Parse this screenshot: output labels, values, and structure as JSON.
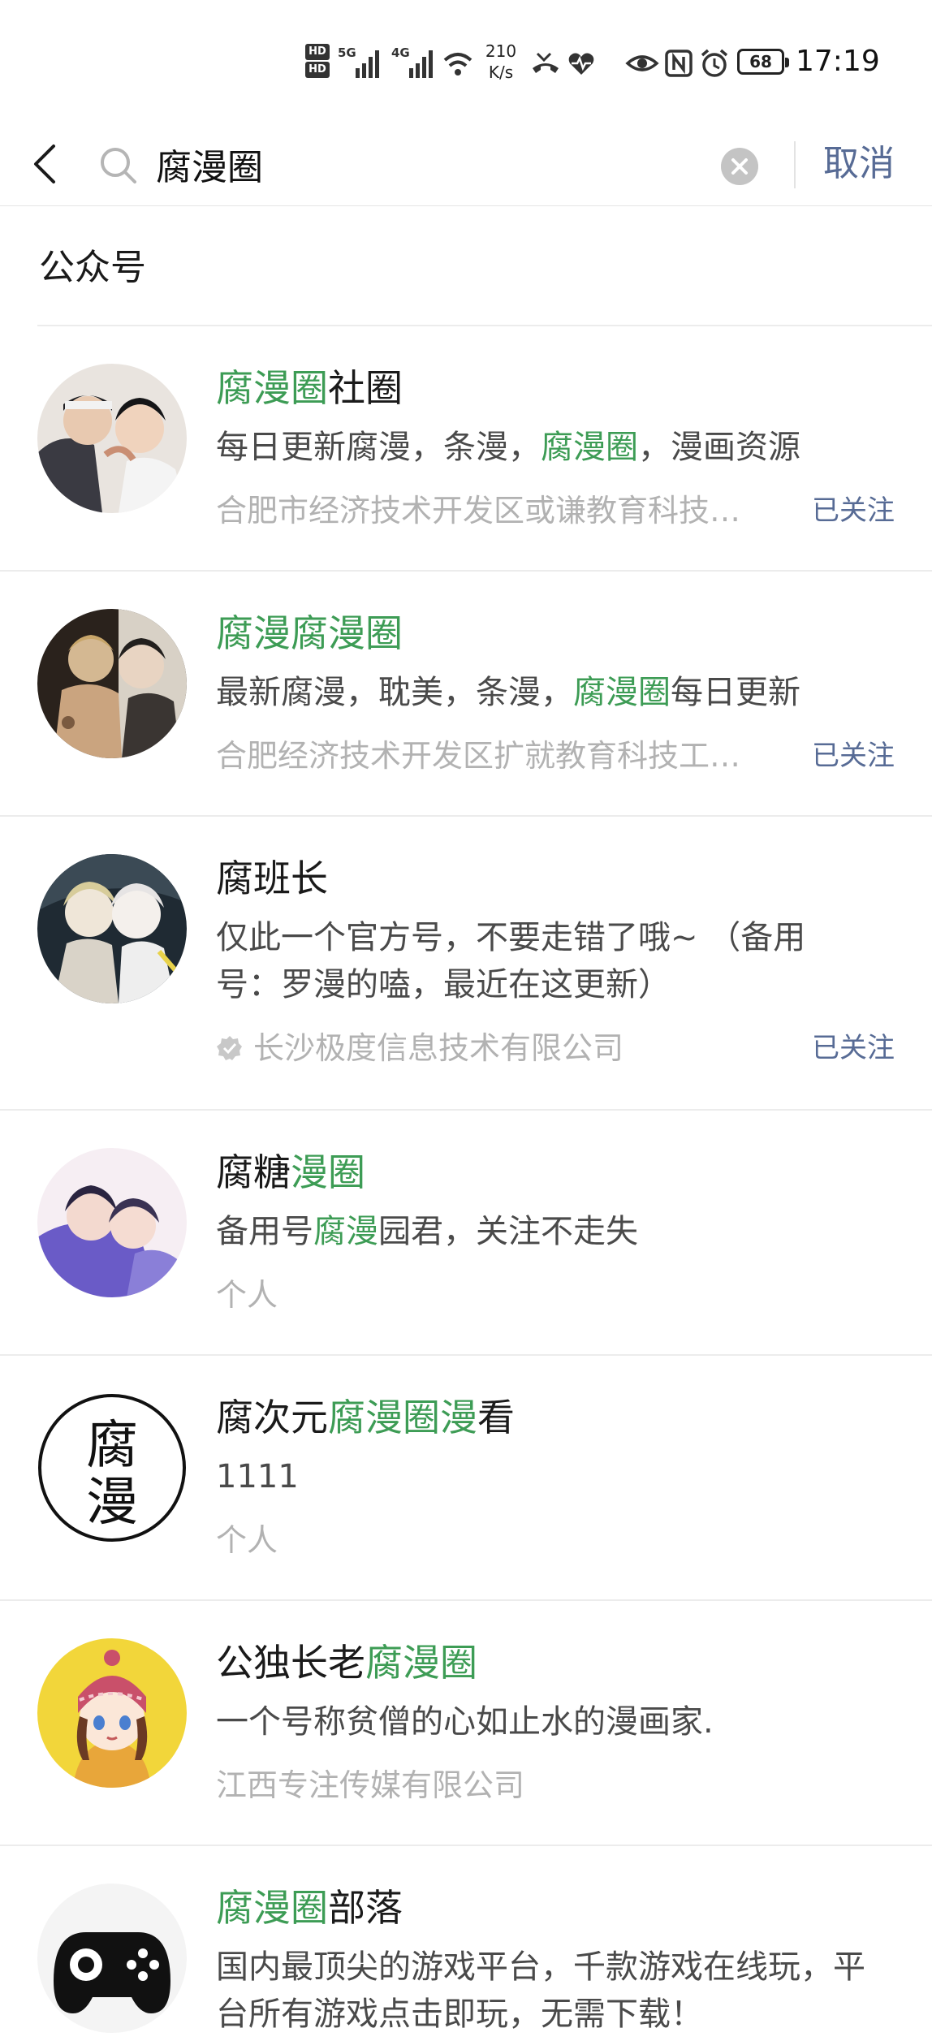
{
  "status_bar": {
    "hd_top": "HD",
    "hd_bottom": "HD",
    "net1": "5G",
    "net2": "4G",
    "speed_value": "210",
    "speed_unit": "K/s",
    "battery": "68",
    "time": "17:19",
    "icons": [
      "signal-icon",
      "wifi-icon",
      "missed-call-icon",
      "health-icon",
      "eye-icon",
      "nfc-icon",
      "alarm-icon",
      "battery-icon"
    ]
  },
  "search": {
    "query": "腐漫圈",
    "cancel_label": "取消"
  },
  "section": {
    "title": "公众号"
  },
  "accent_colors": {
    "highlight": "#3d9c55",
    "link": "#576b95",
    "muted": "#b2b2b2"
  },
  "results": [
    {
      "name_parts": [
        {
          "t": "腐漫圈",
          "hl": true
        },
        {
          "t": "社圈",
          "hl": false
        }
      ],
      "desc_parts": [
        {
          "t": "每日更新腐漫，条漫，",
          "hl": false
        },
        {
          "t": "腐漫圈",
          "hl": true
        },
        {
          "t": "，漫画资源",
          "hl": false
        }
      ],
      "owner": "合肥市经济技术开发区或谦教育科技…",
      "verified": false,
      "follow": "已关注"
    },
    {
      "name_parts": [
        {
          "t": "腐漫腐漫圈",
          "hl": true
        }
      ],
      "desc_parts": [
        {
          "t": "最新腐漫，耽美，条漫，",
          "hl": false
        },
        {
          "t": "腐漫圈",
          "hl": true
        },
        {
          "t": "每日更新",
          "hl": false
        }
      ],
      "owner": "合肥经济技术开发区扩就教育科技工…",
      "verified": false,
      "follow": "已关注"
    },
    {
      "name_parts": [
        {
          "t": "腐班长",
          "hl": false
        }
      ],
      "desc_parts": [
        {
          "t": "仅此一个官方号，不要走错了哦~ （备用号：罗漫的嗑，最近在这更新）",
          "hl": false
        }
      ],
      "owner": "长沙极度信息技术有限公司",
      "verified": true,
      "follow": "已关注"
    },
    {
      "name_parts": [
        {
          "t": "腐糖",
          "hl": false
        },
        {
          "t": "漫圈",
          "hl": true
        }
      ],
      "desc_parts": [
        {
          "t": "备用号",
          "hl": false
        },
        {
          "t": "腐漫",
          "hl": true
        },
        {
          "t": "园君，关注不走失",
          "hl": false
        }
      ],
      "owner": "个人",
      "verified": false,
      "follow": ""
    },
    {
      "name_parts": [
        {
          "t": "腐次元",
          "hl": false
        },
        {
          "t": "腐漫圈漫",
          "hl": true
        },
        {
          "t": "看",
          "hl": false
        }
      ],
      "desc_parts": [
        {
          "t": "1111",
          "hl": false
        }
      ],
      "owner": "个人",
      "verified": false,
      "follow": "",
      "avatar_text_top": "腐",
      "avatar_text_bottom": "漫"
    },
    {
      "name_parts": [
        {
          "t": "公独长老",
          "hl": false
        },
        {
          "t": "腐漫圈",
          "hl": true
        }
      ],
      "desc_parts": [
        {
          "t": "一个号称贫僧的心如止水的漫画家.",
          "hl": false
        }
      ],
      "owner": "江西专注传媒有限公司",
      "verified": false,
      "follow": ""
    },
    {
      "name_parts": [
        {
          "t": "腐漫圈",
          "hl": true
        },
        {
          "t": "部落",
          "hl": false
        }
      ],
      "desc_parts": [
        {
          "t": "国内最顶尖的游戏平台，千款游戏在线玩，平台所有游戏点击即玩，无需下载！",
          "hl": false
        }
      ],
      "owner": "",
      "verified": false,
      "follow": ""
    }
  ]
}
